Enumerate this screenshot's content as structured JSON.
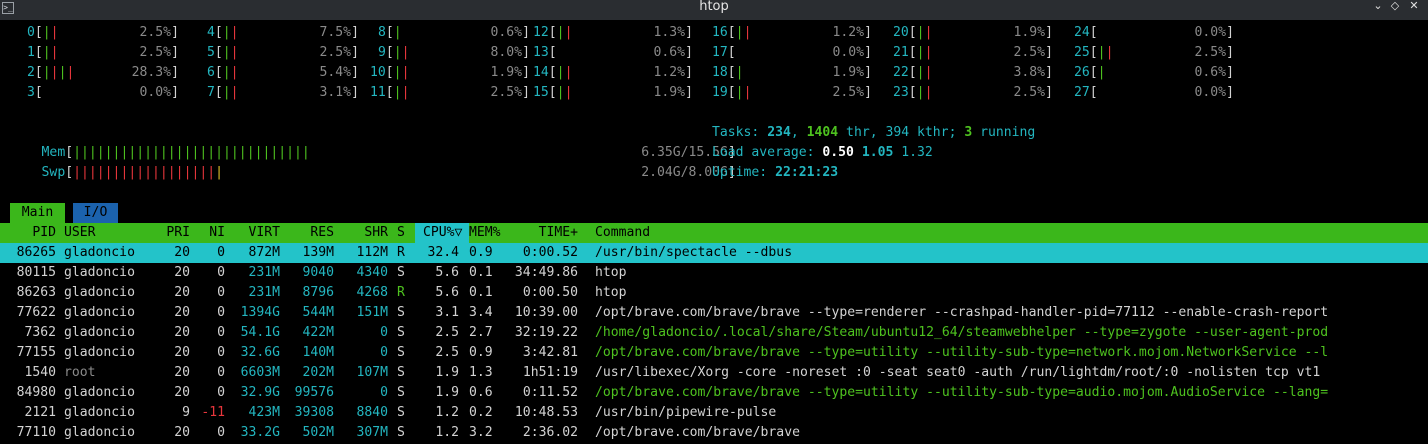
{
  "window": {
    "title": "htop",
    "icon": "terminal-icon"
  },
  "cpus": [
    {
      "id": "0",
      "bar": "||",
      "pct": "2.5%"
    },
    {
      "id": "1",
      "bar": "||",
      "pct": "2.5%"
    },
    {
      "id": "2",
      "bar": "||||",
      "pct": "28.3%"
    },
    {
      "id": "3",
      "bar": "",
      "pct": "0.0%"
    },
    {
      "id": "4",
      "bar": "||",
      "pct": "7.5%"
    },
    {
      "id": "5",
      "bar": "||",
      "pct": "2.5%"
    },
    {
      "id": "6",
      "bar": "||",
      "pct": "5.4%"
    },
    {
      "id": "7",
      "bar": "||",
      "pct": "3.1%"
    },
    {
      "id": "8",
      "bar": "|",
      "pct": "0.6%"
    },
    {
      "id": "9",
      "bar": "||",
      "pct": "8.0%"
    },
    {
      "id": "10",
      "bar": "||",
      "pct": "1.9%"
    },
    {
      "id": "11",
      "bar": "||",
      "pct": "2.5%"
    },
    {
      "id": "12",
      "bar": "||",
      "pct": "1.3%"
    },
    {
      "id": "13",
      "bar": "",
      "pct": "0.6%"
    },
    {
      "id": "14",
      "bar": "||",
      "pct": "1.2%"
    },
    {
      "id": "15",
      "bar": "||",
      "pct": "1.9%"
    },
    {
      "id": "16",
      "bar": "||",
      "pct": "1.2%"
    },
    {
      "id": "17",
      "bar": "",
      "pct": "0.0%"
    },
    {
      "id": "18",
      "bar": "|",
      "pct": "1.9%"
    },
    {
      "id": "19",
      "bar": "||",
      "pct": "2.5%"
    },
    {
      "id": "20",
      "bar": "||",
      "pct": "1.9%"
    },
    {
      "id": "21",
      "bar": "||",
      "pct": "2.5%"
    },
    {
      "id": "22",
      "bar": "||",
      "pct": "3.8%"
    },
    {
      "id": "23",
      "bar": "||",
      "pct": "2.5%"
    },
    {
      "id": "24",
      "bar": "",
      "pct": "0.0%"
    },
    {
      "id": "25",
      "bar": "||",
      "pct": "2.5%"
    },
    {
      "id": "26",
      "bar": "|",
      "pct": "0.6%"
    },
    {
      "id": "27",
      "bar": "",
      "pct": "0.0%"
    }
  ],
  "mem": {
    "label": "Mem",
    "value": "6.35G/15.5G",
    "fill": 0.41
  },
  "swp": {
    "label": "Swp",
    "value": "2.04G/8.00G",
    "fill": 0.26
  },
  "tasks": {
    "prefix": "Tasks: ",
    "count": "234",
    "sep1": ", ",
    "thr": "1404",
    "thr_label": " thr, ",
    "kthr": "394 kthr",
    "sep2": "; ",
    "running": "3",
    "running_label": " running"
  },
  "load": {
    "label": "Load average: ",
    "l1": "0.50",
    "l5": "1.05",
    "l15": "1.32"
  },
  "uptime": {
    "label": "Uptime: ",
    "value": "22:21:23"
  },
  "tabs": {
    "main": "Main",
    "io": "I/O"
  },
  "columns": {
    "pid": "PID",
    "user": "USER",
    "pri": "PRI",
    "ni": "NI",
    "virt": "VIRT",
    "res": "RES",
    "shr": "SHR",
    "s": "S",
    "cpu": "CPU%▽",
    "mem": "MEM%",
    "time": "TIME+",
    "command": "Command"
  },
  "processes": [
    {
      "pid": "86265",
      "user": "gladoncio",
      "pri": "20",
      "ni": "0",
      "virt": "872M",
      "res": "139M",
      "shr": "112M",
      "s": "R",
      "cpu": "32.4",
      "mem": "0.9",
      "time": "0:00.52",
      "command": "/usr/bin/spectacle --dbus"
    },
    {
      "pid": "80115",
      "user": "gladoncio",
      "pri": "20",
      "ni": "0",
      "virt": "231M",
      "res": "9040",
      "shr": "4340",
      "s": "S",
      "cpu": "5.6",
      "mem": "0.1",
      "time": "34:49.86",
      "command": "htop"
    },
    {
      "pid": "86263",
      "user": "gladoncio",
      "pri": "20",
      "ni": "0",
      "virt": "231M",
      "res": "8796",
      "shr": "4268",
      "s": "R",
      "cpu": "5.6",
      "mem": "0.1",
      "time": "0:00.50",
      "command": "htop"
    },
    {
      "pid": "77622",
      "user": "gladoncio",
      "pri": "20",
      "ni": "0",
      "virt": "1394G",
      "res": "544M",
      "shr": "151M",
      "s": "S",
      "cpu": "3.1",
      "mem": "3.4",
      "time": "10:39.00",
      "command": "/opt/brave.com/brave/brave --type=renderer --crashpad-handler-pid=77112 --enable-crash-report"
    },
    {
      "pid": "7362",
      "user": "gladoncio",
      "pri": "20",
      "ni": "0",
      "virt": "54.1G",
      "res": "422M",
      "shr": "0",
      "s": "S",
      "cpu": "2.5",
      "mem": "2.7",
      "time": "32:19.22",
      "command": "/home/gladoncio/.local/share/Steam/ubuntu12_64/steamwebhelper --type=zygote --user-agent-prod"
    },
    {
      "pid": "77155",
      "user": "gladoncio",
      "pri": "20",
      "ni": "0",
      "virt": "32.6G",
      "res": "140M",
      "shr": "0",
      "s": "S",
      "cpu": "2.5",
      "mem": "0.9",
      "time": "3:42.81",
      "command": "/opt/brave.com/brave/brave --type=utility --utility-sub-type=network.mojom.NetworkService --l"
    },
    {
      "pid": "1540",
      "user": "root",
      "pri": "20",
      "ni": "0",
      "virt": "6603M",
      "res": "202M",
      "shr": "107M",
      "s": "S",
      "cpu": "1.9",
      "mem": "1.3",
      "time": "1h51:19",
      "command": "/usr/libexec/Xorg -core -noreset :0 -seat seat0 -auth /run/lightdm/root/:0 -nolisten tcp vt1"
    },
    {
      "pid": "84980",
      "user": "gladoncio",
      "pri": "20",
      "ni": "0",
      "virt": "32.9G",
      "res": "99576",
      "shr": "0",
      "s": "S",
      "cpu": "1.9",
      "mem": "0.6",
      "time": "0:11.52",
      "command": "/opt/brave.com/brave/brave --type=utility --utility-sub-type=audio.mojom.AudioService --lang="
    },
    {
      "pid": "2121",
      "user": "gladoncio",
      "pri": "9",
      "ni": "-11",
      "virt": "423M",
      "res": "39308",
      "shr": "8840",
      "s": "S",
      "cpu": "1.2",
      "mem": "0.2",
      "time": "10:48.53",
      "command": "/usr/bin/pipewire-pulse"
    },
    {
      "pid": "77110",
      "user": "gladoncio",
      "pri": "20",
      "ni": "0",
      "virt": "33.2G",
      "res": "502M",
      "shr": "307M",
      "s": "S",
      "cpu": "1.2",
      "mem": "3.2",
      "time": "2:36.02",
      "command": "/opt/brave.com/brave/brave"
    }
  ],
  "colors": {
    "green": "#4ec21f",
    "red": "#e8363c",
    "cyan": "#23b6c0",
    "header": "#3bb71b",
    "selection": "#23c3c9",
    "io_tab": "#1b62ad"
  }
}
